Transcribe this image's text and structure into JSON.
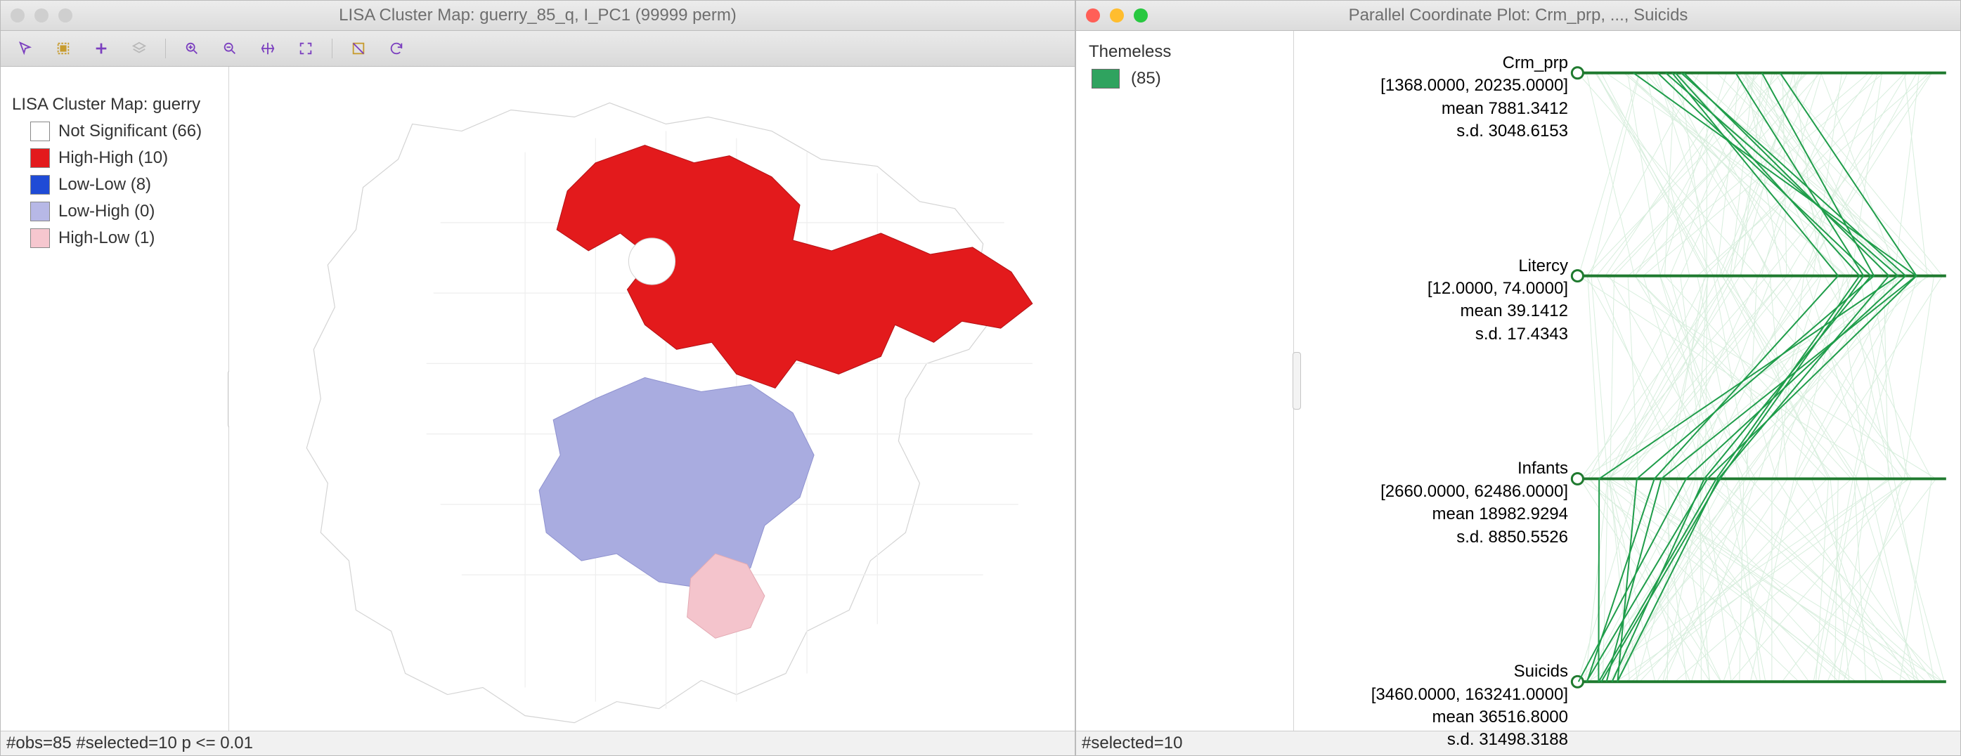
{
  "left_window": {
    "title": "LISA Cluster Map: guerry_85_q, I_PC1 (99999 perm)",
    "toolbar": [
      {
        "name": "arrow-icon"
      },
      {
        "name": "select-rect-icon"
      },
      {
        "name": "plus-icon"
      },
      {
        "name": "layers-icon"
      },
      {
        "sep": true
      },
      {
        "name": "zoom-in-icon"
      },
      {
        "name": "zoom-out-icon"
      },
      {
        "name": "pan-icon"
      },
      {
        "name": "extent-icon"
      },
      {
        "sep": true
      },
      {
        "name": "selection-shape-icon"
      },
      {
        "name": "refresh-icon"
      }
    ],
    "legend": {
      "title": "LISA Cluster Map: guerry",
      "items": [
        {
          "label": "Not Significant (66)",
          "color": "#ffffff"
        },
        {
          "label": "High-High (10)",
          "color": "#e31a1c"
        },
        {
          "label": "Low-Low (8)",
          "color": "#1f4bd6"
        },
        {
          "label": "Low-High (0)",
          "color": "#b7b8e6"
        },
        {
          "label": "High-Low (1)",
          "color": "#f6c7cf"
        }
      ]
    },
    "status": "#obs=85 #selected=10   p <= 0.01"
  },
  "right_window": {
    "title": "Parallel Coordinate Plot: Crm_prp, ..., Suicids",
    "theme": {
      "title": "Themeless",
      "count_label": "(85)",
      "swatch": "#2fa35f"
    },
    "status": "#selected=10",
    "accent": "#1f7a2f"
  },
  "chart_data": {
    "type": "parallel_coordinates",
    "axes": [
      {
        "name": "Crm_prp",
        "range": [
          1368.0,
          20235.0
        ],
        "range_label": "[1368.0000, 20235.0000]",
        "mean": 7881.3412,
        "mean_label": "mean  7881.3412",
        "sd": 3048.6153,
        "sd_label": "s.d.  3048.6153"
      },
      {
        "name": "Litercy",
        "range": [
          12.0,
          74.0
        ],
        "range_label": "[12.0000, 74.0000]",
        "mean": 39.1412,
        "mean_label": "mean  39.1412",
        "sd": 17.4343,
        "sd_label": "s.d.  17.4343"
      },
      {
        "name": "Infants",
        "range": [
          2660.0,
          62486.0
        ],
        "range_label": "[2660.0000, 62486.0000]",
        "mean": 18982.9294,
        "mean_label": "mean  18982.9294",
        "sd": 8850.5526,
        "sd_label": "s.d.  8850.5526"
      },
      {
        "name": "Suicids",
        "range": [
          3460.0,
          163241.0
        ],
        "range_label": "[3460.0000, 163241.0000]",
        "mean": 36516.8,
        "mean_label": "mean  36516.8000",
        "sd": 31498.3188,
        "sd_label": "s.d.  31498.3188"
      }
    ],
    "n_observations": 85,
    "n_selected": 10
  }
}
